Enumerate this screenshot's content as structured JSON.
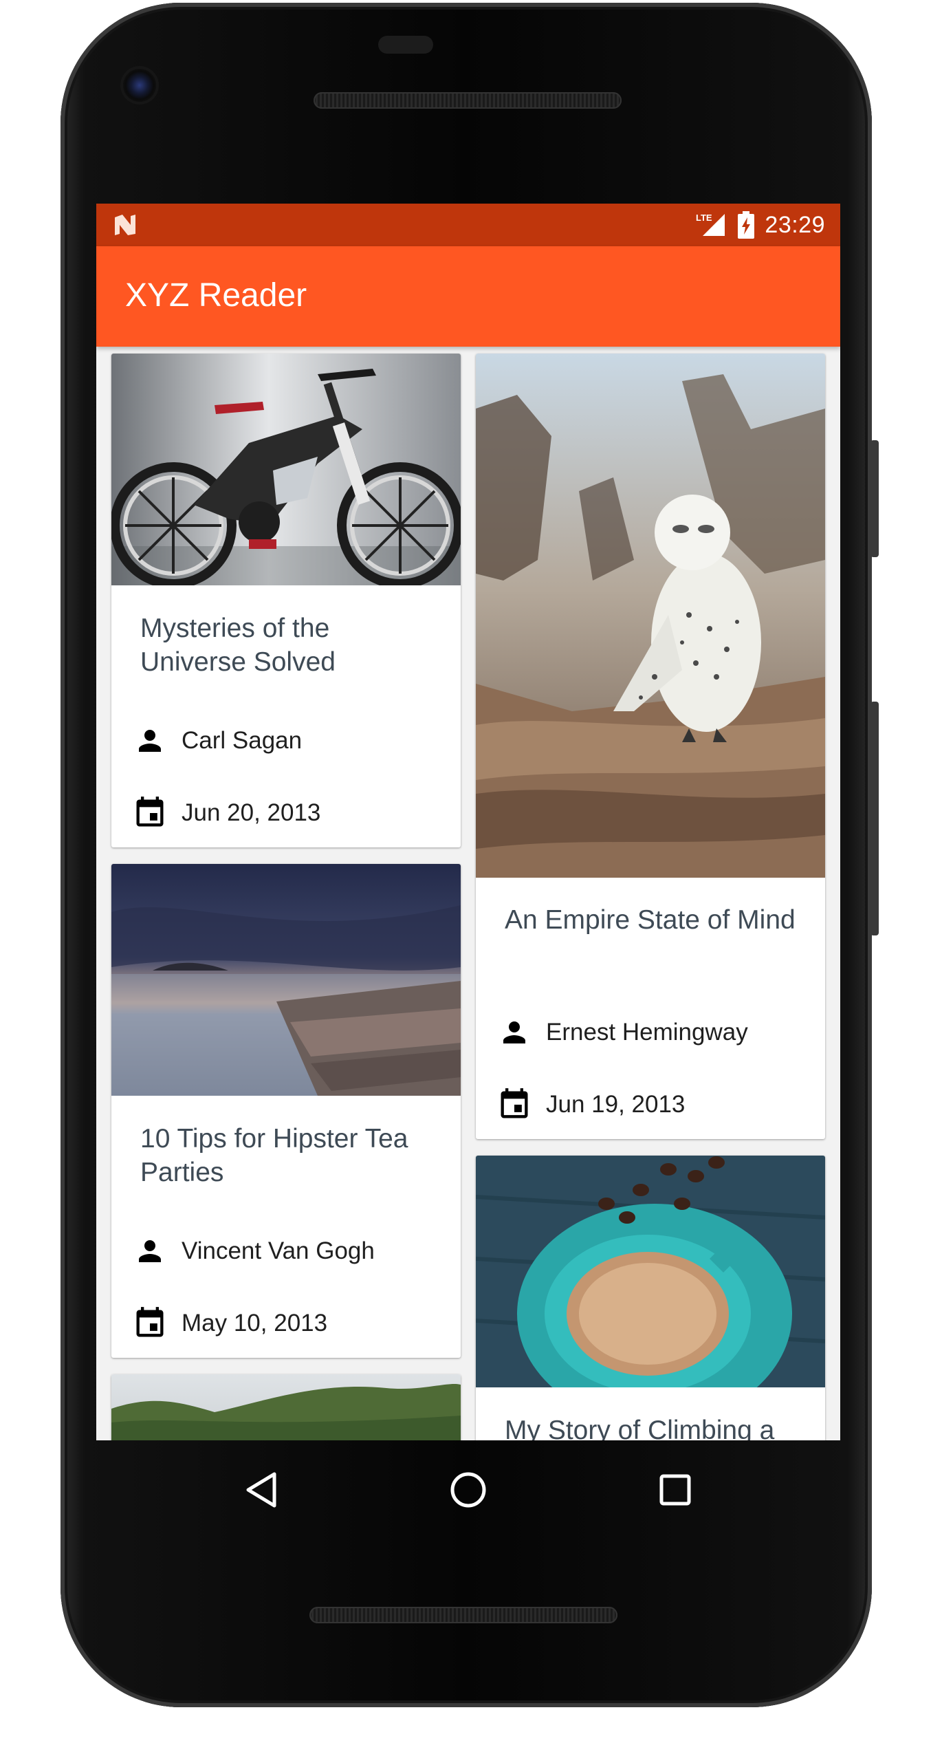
{
  "status_bar": {
    "network": "LTE",
    "time": "23:29"
  },
  "app_bar": {
    "title": "XYZ Reader"
  },
  "articles": [
    {
      "title": "Mysteries of the Universe Solved",
      "author": "Carl Sagan",
      "date": "Jun 20, 2013",
      "image": "electric-bicycle-photo"
    },
    {
      "title": "An Empire State of Mind",
      "author": "Ernest Hemingway",
      "date": "Jun 19, 2013",
      "image": "snowy-owl-photo"
    },
    {
      "title": "10 Tips for Hipster Tea Parties",
      "author": "Vincent Van Gogh",
      "date": "May 10, 2013",
      "image": "rocky-shore-sunset-photo"
    },
    {
      "title": "My Story of Climbing a",
      "image": "coffee-cup-photo"
    },
    {
      "image": "green-hills-photo"
    }
  ],
  "icons": {
    "author": "person-icon",
    "date": "calendar-icon",
    "back": "back-triangle-icon",
    "home": "home-circle-icon",
    "recents": "recents-square-icon"
  },
  "colors": {
    "status_bar": "#bf360c",
    "app_bar": "#ff5722",
    "title_text": "#3e4a55"
  }
}
